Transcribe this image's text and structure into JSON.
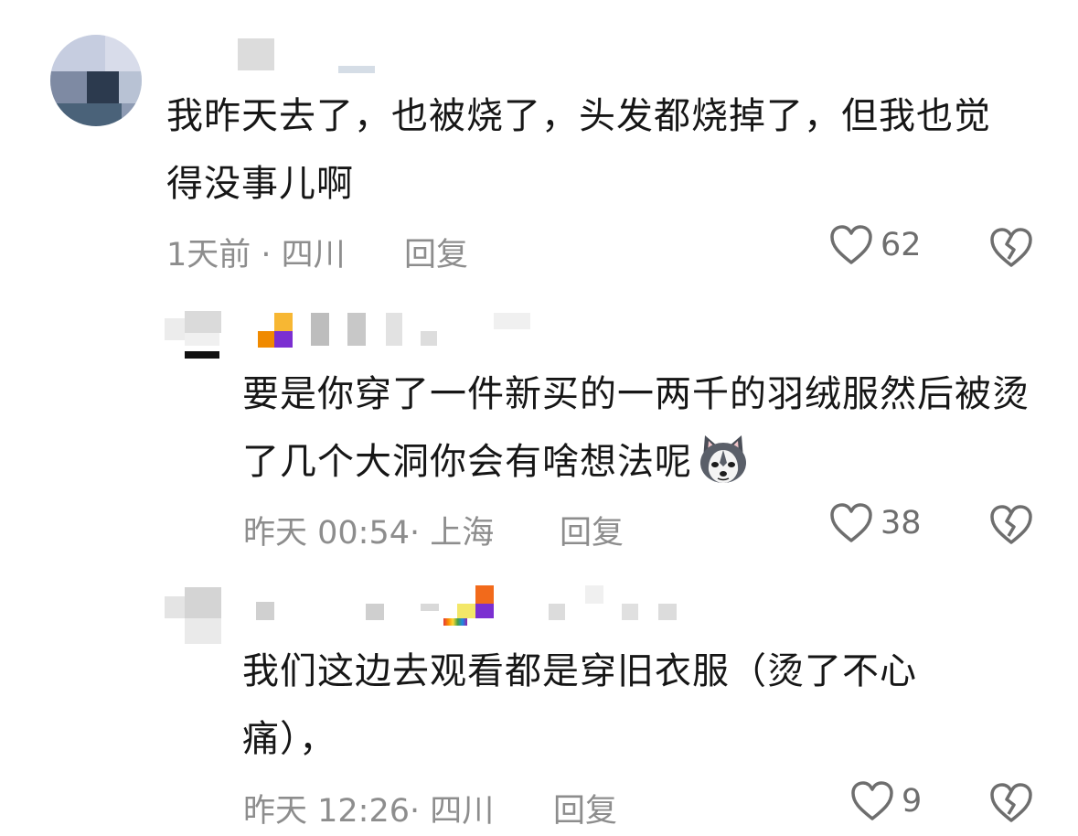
{
  "comments": [
    {
      "text": "我昨天去了，也被烧了，头发都烧掉了，但我也觉得没事儿啊",
      "time": "1天前",
      "location": "四川",
      "reply_label": "回复",
      "likes": "62",
      "avatar_colors": [
        "#9aa3b5",
        "#4e5d74",
        "#c9d2e4",
        "#243143"
      ]
    },
    {
      "text": "要是你穿了一件新买的一两千的羽绒服然后被烫了几个大洞你会有啥想法呢",
      "emoji": "husky-dog-emoji",
      "time": "昨天 00:54",
      "location": "上海",
      "reply_label": "回复",
      "likes": "38"
    },
    {
      "text": "我们这边去观看都是穿旧衣服（烫了不心痛），",
      "time": "昨天 12:26",
      "location": "四川",
      "reply_label": "回复",
      "likes": "9"
    }
  ],
  "icons": {
    "like": "heart-outline-icon",
    "dislike": "broken-heart-icon"
  },
  "colors": {
    "text": "#161616",
    "meta": "#8d8d8d",
    "icon": "#6e6e6e"
  }
}
